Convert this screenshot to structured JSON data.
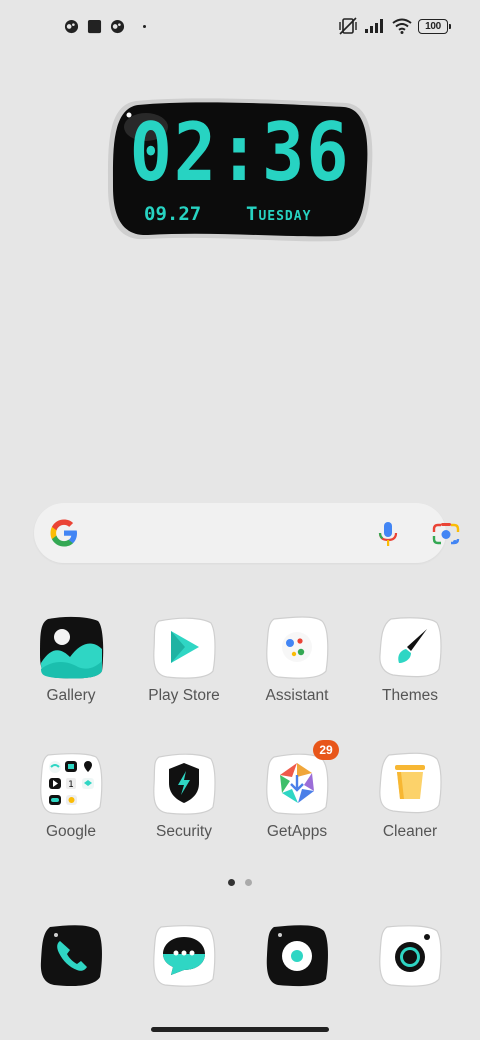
{
  "status_bar": {
    "battery": "100",
    "left_icons": [
      "notification-app-icon",
      "notification-square-icon",
      "notification-app-icon"
    ],
    "right_icons": [
      "vibrate-off-icon",
      "signal-icon",
      "wifi-icon",
      "battery-icon"
    ]
  },
  "clock": {
    "time": "02:36",
    "date": "09.27",
    "day": "Tuesday",
    "color": "#27d3c2"
  },
  "search": {
    "icons": [
      "google-g-icon",
      "microphone-icon",
      "google-lens-icon"
    ]
  },
  "apps": {
    "row1": [
      {
        "label": "Gallery",
        "icon": "gallery-icon"
      },
      {
        "label": "Play Store",
        "icon": "play-store-icon"
      },
      {
        "label": "Assistant",
        "icon": "assistant-icon"
      },
      {
        "label": "Themes",
        "icon": "themes-icon"
      }
    ],
    "row2": [
      {
        "label": "Google",
        "icon": "google-folder-icon"
      },
      {
        "label": "Security",
        "icon": "security-icon"
      },
      {
        "label": "GetApps",
        "icon": "getapps-icon",
        "badge": "29"
      },
      {
        "label": "Cleaner",
        "icon": "cleaner-icon"
      }
    ]
  },
  "dock": [
    {
      "icon": "phone-icon"
    },
    {
      "icon": "messages-icon"
    },
    {
      "icon": "browser-icon"
    },
    {
      "icon": "camera-icon"
    }
  ],
  "pages": {
    "count": 2,
    "active": 1
  }
}
